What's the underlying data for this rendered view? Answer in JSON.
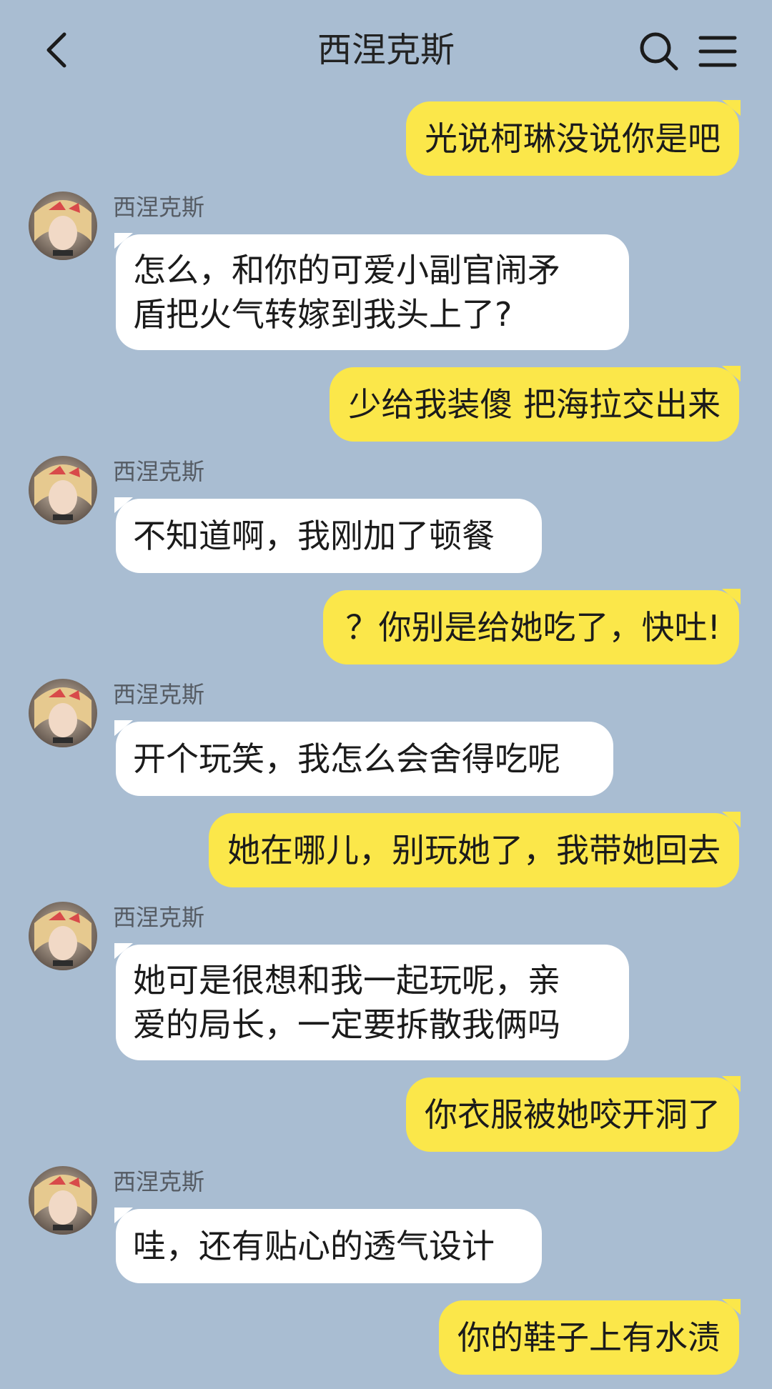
{
  "header": {
    "title": "西涅克斯",
    "back_icon": "chevron-left-icon",
    "search_icon": "search-icon",
    "menu_icon": "menu-icon"
  },
  "colors": {
    "background": "#a9bdd2",
    "my_bubble": "#fbe74a",
    "their_bubble": "#ffffff"
  },
  "messages": [
    {
      "from": "me",
      "text": "光说柯琳没说你是吧"
    },
    {
      "from": "them",
      "sender": "西涅克斯",
      "lines": [
        "怎么，和你的可爱小副官闹矛",
        "盾把火气转嫁到我头上了?"
      ]
    },
    {
      "from": "me",
      "text": "少给我装傻 把海拉交出来"
    },
    {
      "from": "them",
      "sender": "西涅克斯",
      "lines": [
        "不知道啊，我刚加了顿餐"
      ]
    },
    {
      "from": "me",
      "text": "？你别是给她吃了，快吐!"
    },
    {
      "from": "them",
      "sender": "西涅克斯",
      "lines": [
        "开个玩笑，我怎么会舍得吃呢"
      ]
    },
    {
      "from": "me",
      "text": "她在哪儿，别玩她了，我带她回去"
    },
    {
      "from": "them",
      "sender": "西涅克斯",
      "lines": [
        "她可是很想和我一起玩呢，亲",
        "爱的局长，一定要拆散我俩吗"
      ]
    },
    {
      "from": "me",
      "text": "你衣服被她咬开洞了"
    },
    {
      "from": "them",
      "sender": "西涅克斯",
      "lines": [
        "哇，还有贴心的透气设计"
      ]
    },
    {
      "from": "me",
      "text": "你的鞋子上有水渍"
    }
  ]
}
